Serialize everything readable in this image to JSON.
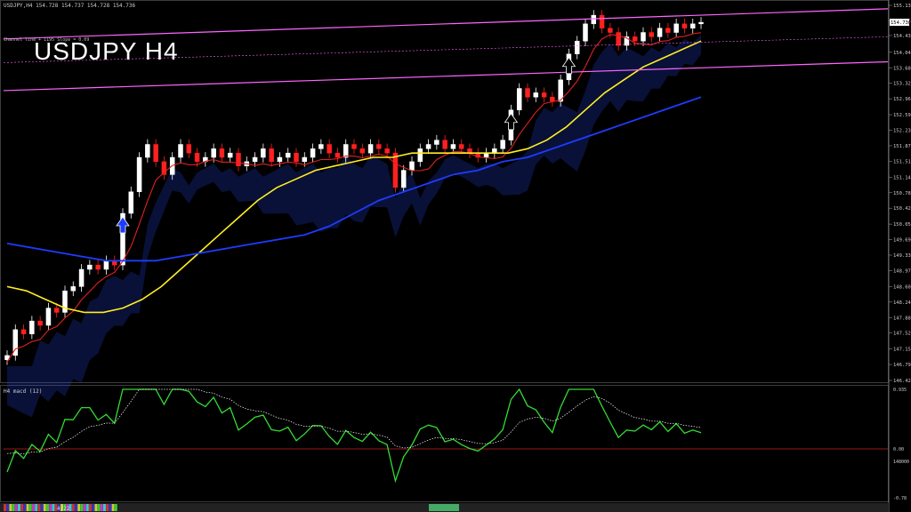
{
  "header": {
    "symbol_line": "USDJPY,H4  154.728 154.737 154.728 154.736",
    "title": "USDJPY H4",
    "subtitle": "Channel line + 1195 Slope = 0.09"
  },
  "macd": {
    "label": "H4  macd (12)",
    "scale": [
      "0.935",
      "0.00",
      "-0.78",
      "148000"
    ]
  },
  "colors": {
    "background": "#000000",
    "bull_candle": "#ffffff",
    "bear_candle": "#ff2020",
    "ma_yellow": "#ffee22",
    "ma_blue": "#1e3cff",
    "ma_red": "#e02020",
    "channel_pink": "#ff66ff",
    "cloud_blue": "#2a4cff",
    "cloud_red": "#ff3030",
    "macd_main": "#33dd33",
    "macd_signal": "#ffffff",
    "zero_line": "#cc2020",
    "axis_text": "#cfcfcf"
  },
  "bottom_bar": {
    "time_label": "4/22"
  },
  "chart_data": {
    "type": "line",
    "title": "USDJPY H4",
    "xlabel": "",
    "ylabel": "",
    "ylim": [
      146.42,
      155.13
    ],
    "price_ticks": [
      "155.130",
      "154.765",
      "154.430",
      "154.040",
      "153.680",
      "153.320",
      "152.960",
      "152.590",
      "152.230",
      "151.870",
      "151.510",
      "151.140",
      "150.780",
      "150.420",
      "150.050",
      "149.690",
      "149.330",
      "148.970",
      "148.600",
      "148.240",
      "147.880",
      "147.520",
      "147.150",
      "146.790",
      "146.420"
    ],
    "last_price_label": "154.736",
    "grid": false,
    "series": [
      {
        "values": [
          147.0,
          147.6,
          147.5,
          147.8,
          147.7,
          148.1,
          148.0,
          148.5,
          148.6,
          149.0,
          149.1,
          149.0,
          149.2,
          149.1,
          150.3,
          150.8,
          151.6,
          151.9,
          151.5,
          151.2,
          151.6,
          151.9,
          151.7,
          151.5,
          151.6,
          151.8,
          151.6,
          151.7,
          151.4,
          151.5,
          151.6,
          151.8,
          151.5,
          151.6,
          151.7,
          151.5,
          151.6,
          151.8,
          151.9,
          151.7,
          151.6,
          151.9,
          151.8,
          151.7,
          151.9,
          151.8,
          151.7,
          150.9,
          151.3,
          151.5,
          151.8,
          151.9,
          152.0,
          151.8,
          151.9,
          151.8,
          151.7,
          151.6,
          151.7,
          151.8,
          152.0,
          152.7,
          153.2,
          153.0,
          153.1,
          153.0,
          152.9,
          153.4,
          154.0,
          154.3,
          154.7,
          154.9,
          154.6,
          154.5,
          154.2,
          154.4,
          154.3,
          154.5,
          154.4,
          154.6,
          154.5,
          154.7,
          154.6,
          154.7,
          154.736
        ]
      },
      {
        "values": [
          148.6,
          148.5,
          148.3,
          148.1,
          148.0,
          148.0,
          148.1,
          148.3,
          148.6,
          149.0,
          149.4,
          149.8,
          150.2,
          150.6,
          150.9,
          151.1,
          151.3,
          151.4,
          151.5,
          151.6,
          151.6,
          151.7,
          151.7,
          151.7,
          151.7,
          151.7,
          151.7,
          151.8,
          152.0,
          152.3,
          152.7,
          153.1,
          153.4,
          153.7,
          153.9,
          154.1,
          154.3
        ]
      },
      {
        "values": [
          149.6,
          149.5,
          149.4,
          149.3,
          149.2,
          149.2,
          149.2,
          149.3,
          149.4,
          149.5,
          149.6,
          149.7,
          149.8,
          150.0,
          150.3,
          150.6,
          150.8,
          151.0,
          151.2,
          151.3,
          151.5,
          151.6,
          151.8,
          152.0,
          152.2,
          152.4,
          152.6,
          152.8,
          153.0
        ]
      }
    ]
  }
}
